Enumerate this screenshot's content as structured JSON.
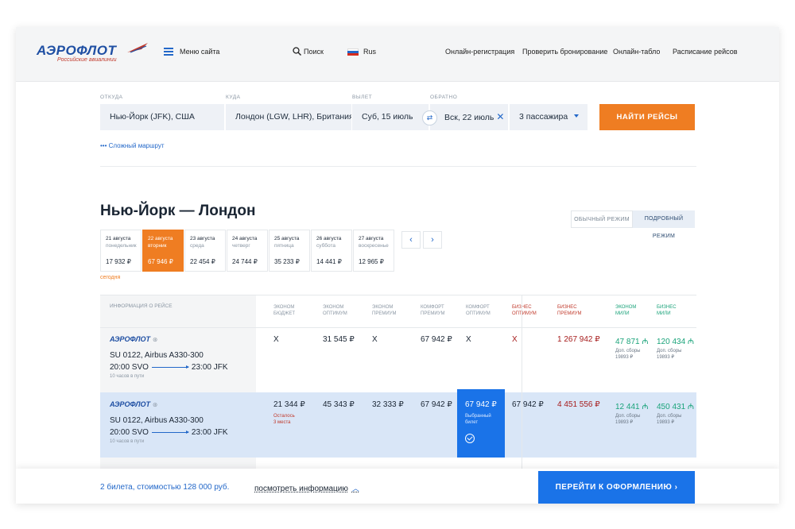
{
  "header": {
    "logo": "АЭРОФЛОТ",
    "logo_sub": "Российские авиалинии",
    "menu_label": "Меню сайта",
    "search_label": "Поиск",
    "lang_label": "Rus",
    "nav": [
      "Онлайн-регистрация",
      "Проверить бронирование",
      "Онлайн-табло",
      "Расписание рейсов"
    ]
  },
  "search": {
    "from_label": "ОТКУДА",
    "to_label": "КУДА",
    "depart_label": "ВЫЛЕТ",
    "return_label": "ОБРАТНО",
    "from_value": "Нью-Йорк (JFK), США",
    "to_value": "Лондон (LGW, LHR), Британия",
    "depart_value": "Суб, 15 июль",
    "return_value": "Вск, 22 июль",
    "passengers": "3 пассажира",
    "find_button": "НАЙТИ РЕЙСЫ",
    "complex_route": "Сложный маршрут"
  },
  "results": {
    "route_title": "Нью-Йорк — Лондон",
    "mode_normal": "ОБЫЧНЫЙ РЕЖИМ",
    "mode_detail": "ПОДРОБНЫЙ РЕЖИМ",
    "today_label": "сегодня",
    "dates": [
      {
        "date": "21 августа",
        "day": "понедельник",
        "price": "17 932 ₽"
      },
      {
        "date": "22 августа",
        "day": "вторник",
        "price": "67 946 ₽"
      },
      {
        "date": "23 августа",
        "day": "среда",
        "price": "22 454 ₽"
      },
      {
        "date": "24 августа",
        "day": "четверг",
        "price": "24 744 ₽"
      },
      {
        "date": "25 августа",
        "day": "пятница",
        "price": "35 233 ₽"
      },
      {
        "date": "26 августа",
        "day": "суббота",
        "price": "14 441 ₽"
      },
      {
        "date": "27 августа",
        "day": "воскресенье",
        "price": "12 965 ₽"
      }
    ]
  },
  "table": {
    "info_header": "ИНФОРМАЦИЯ О РЕЙСЕ",
    "columns": [
      "ЭКОНОМ\nБЮДЖЕТ",
      "ЭКОНОМ\nОПТИМУМ",
      "ЭКОНОМ\nПРЕМИУМ",
      "КОМФОРТ\nПРЕМИУМ",
      "КОМФОРТ\nОПТИМУМ",
      "БИЗНЕС\nОПТИМУМ",
      "БИЗНЕС\nПРЕМИУМ",
      "ЭКОНОМ\nМИЛИ",
      "БИЗНЕС\nМИЛИ"
    ],
    "rows": [
      {
        "airline": "АЭРОФЛОТ",
        "flight": "SU 0122, Airbus A330-300",
        "dep": "20:00 SVO",
        "arr": "23:00 JFK",
        "duration": "10 часов в пути",
        "prices": [
          "Х",
          "31 545 ₽",
          "Х",
          "67 942 ₽",
          "Х",
          "Х",
          "1 267 942 ₽",
          "47 871 ₼",
          "120 434 ₼"
        ],
        "miles_fee_1": "Доп. сборы\n19893 ₽",
        "miles_fee_2": "Доп. сборы\n19893 ₽"
      },
      {
        "airline": "АЭРОФЛОТ",
        "flight": "SU 0122, Airbus A330-300",
        "dep": "20:00 SVO",
        "arr": "23:00 JFK",
        "duration": "10 часов в пути",
        "prices": [
          "21 344 ₽",
          "45 343 ₽",
          "32 333 ₽",
          "67 942 ₽",
          "67 942 ₽",
          "67 942 ₽",
          "4 451 556 ₽",
          "12 441 ₼",
          "450 431 ₼"
        ],
        "seats_left": "Осталось\n3 места",
        "selected_label": "Выбранный\nбилет",
        "miles_fee_1": "Доп. сборы\n19893 ₽",
        "miles_fee_2": "Доп. сборы\n19893 ₽"
      }
    ]
  },
  "footer": {
    "tickets": "2 билета, стоимостью 128 000 руб.",
    "see_info": "посмотреть информацию",
    "go_button": "ПЕРЕЙТИ К ОФОРМЛЕНИЮ"
  },
  "colors": {
    "accent": "#ef7d22",
    "primary": "#1a73e8",
    "brand": "#1f4fa3"
  }
}
